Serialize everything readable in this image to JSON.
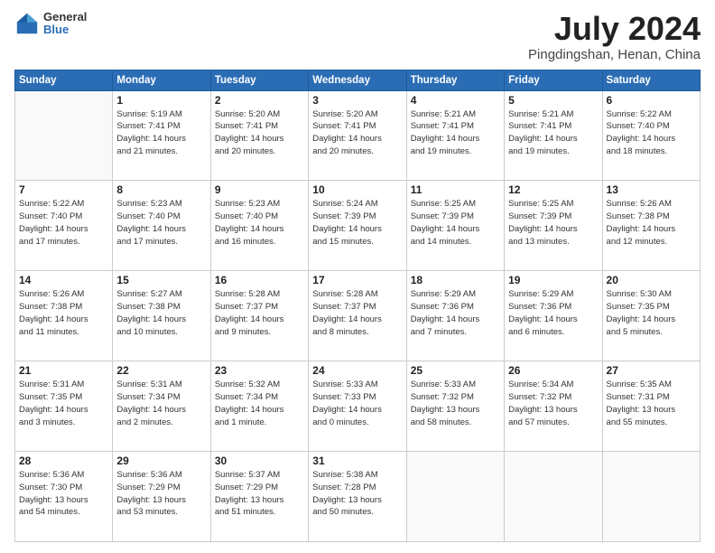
{
  "logo": {
    "general": "General",
    "blue": "Blue"
  },
  "title": "July 2024",
  "subtitle": "Pingdingshan, Henan, China",
  "days_header": [
    "Sunday",
    "Monday",
    "Tuesday",
    "Wednesday",
    "Thursday",
    "Friday",
    "Saturday"
  ],
  "weeks": [
    [
      {
        "day": "",
        "info": ""
      },
      {
        "day": "1",
        "info": "Sunrise: 5:19 AM\nSunset: 7:41 PM\nDaylight: 14 hours\nand 21 minutes."
      },
      {
        "day": "2",
        "info": "Sunrise: 5:20 AM\nSunset: 7:41 PM\nDaylight: 14 hours\nand 20 minutes."
      },
      {
        "day": "3",
        "info": "Sunrise: 5:20 AM\nSunset: 7:41 PM\nDaylight: 14 hours\nand 20 minutes."
      },
      {
        "day": "4",
        "info": "Sunrise: 5:21 AM\nSunset: 7:41 PM\nDaylight: 14 hours\nand 19 minutes."
      },
      {
        "day": "5",
        "info": "Sunrise: 5:21 AM\nSunset: 7:41 PM\nDaylight: 14 hours\nand 19 minutes."
      },
      {
        "day": "6",
        "info": "Sunrise: 5:22 AM\nSunset: 7:40 PM\nDaylight: 14 hours\nand 18 minutes."
      }
    ],
    [
      {
        "day": "7",
        "info": "Sunrise: 5:22 AM\nSunset: 7:40 PM\nDaylight: 14 hours\nand 17 minutes."
      },
      {
        "day": "8",
        "info": "Sunrise: 5:23 AM\nSunset: 7:40 PM\nDaylight: 14 hours\nand 17 minutes."
      },
      {
        "day": "9",
        "info": "Sunrise: 5:23 AM\nSunset: 7:40 PM\nDaylight: 14 hours\nand 16 minutes."
      },
      {
        "day": "10",
        "info": "Sunrise: 5:24 AM\nSunset: 7:39 PM\nDaylight: 14 hours\nand 15 minutes."
      },
      {
        "day": "11",
        "info": "Sunrise: 5:25 AM\nSunset: 7:39 PM\nDaylight: 14 hours\nand 14 minutes."
      },
      {
        "day": "12",
        "info": "Sunrise: 5:25 AM\nSunset: 7:39 PM\nDaylight: 14 hours\nand 13 minutes."
      },
      {
        "day": "13",
        "info": "Sunrise: 5:26 AM\nSunset: 7:38 PM\nDaylight: 14 hours\nand 12 minutes."
      }
    ],
    [
      {
        "day": "14",
        "info": "Sunrise: 5:26 AM\nSunset: 7:38 PM\nDaylight: 14 hours\nand 11 minutes."
      },
      {
        "day": "15",
        "info": "Sunrise: 5:27 AM\nSunset: 7:38 PM\nDaylight: 14 hours\nand 10 minutes."
      },
      {
        "day": "16",
        "info": "Sunrise: 5:28 AM\nSunset: 7:37 PM\nDaylight: 14 hours\nand 9 minutes."
      },
      {
        "day": "17",
        "info": "Sunrise: 5:28 AM\nSunset: 7:37 PM\nDaylight: 14 hours\nand 8 minutes."
      },
      {
        "day": "18",
        "info": "Sunrise: 5:29 AM\nSunset: 7:36 PM\nDaylight: 14 hours\nand 7 minutes."
      },
      {
        "day": "19",
        "info": "Sunrise: 5:29 AM\nSunset: 7:36 PM\nDaylight: 14 hours\nand 6 minutes."
      },
      {
        "day": "20",
        "info": "Sunrise: 5:30 AM\nSunset: 7:35 PM\nDaylight: 14 hours\nand 5 minutes."
      }
    ],
    [
      {
        "day": "21",
        "info": "Sunrise: 5:31 AM\nSunset: 7:35 PM\nDaylight: 14 hours\nand 3 minutes."
      },
      {
        "day": "22",
        "info": "Sunrise: 5:31 AM\nSunset: 7:34 PM\nDaylight: 14 hours\nand 2 minutes."
      },
      {
        "day": "23",
        "info": "Sunrise: 5:32 AM\nSunset: 7:34 PM\nDaylight: 14 hours\nand 1 minute."
      },
      {
        "day": "24",
        "info": "Sunrise: 5:33 AM\nSunset: 7:33 PM\nDaylight: 14 hours\nand 0 minutes."
      },
      {
        "day": "25",
        "info": "Sunrise: 5:33 AM\nSunset: 7:32 PM\nDaylight: 13 hours\nand 58 minutes."
      },
      {
        "day": "26",
        "info": "Sunrise: 5:34 AM\nSunset: 7:32 PM\nDaylight: 13 hours\nand 57 minutes."
      },
      {
        "day": "27",
        "info": "Sunrise: 5:35 AM\nSunset: 7:31 PM\nDaylight: 13 hours\nand 55 minutes."
      }
    ],
    [
      {
        "day": "28",
        "info": "Sunrise: 5:36 AM\nSunset: 7:30 PM\nDaylight: 13 hours\nand 54 minutes."
      },
      {
        "day": "29",
        "info": "Sunrise: 5:36 AM\nSunset: 7:29 PM\nDaylight: 13 hours\nand 53 minutes."
      },
      {
        "day": "30",
        "info": "Sunrise: 5:37 AM\nSunset: 7:29 PM\nDaylight: 13 hours\nand 51 minutes."
      },
      {
        "day": "31",
        "info": "Sunrise: 5:38 AM\nSunset: 7:28 PM\nDaylight: 13 hours\nand 50 minutes."
      },
      {
        "day": "",
        "info": ""
      },
      {
        "day": "",
        "info": ""
      },
      {
        "day": "",
        "info": ""
      }
    ]
  ]
}
